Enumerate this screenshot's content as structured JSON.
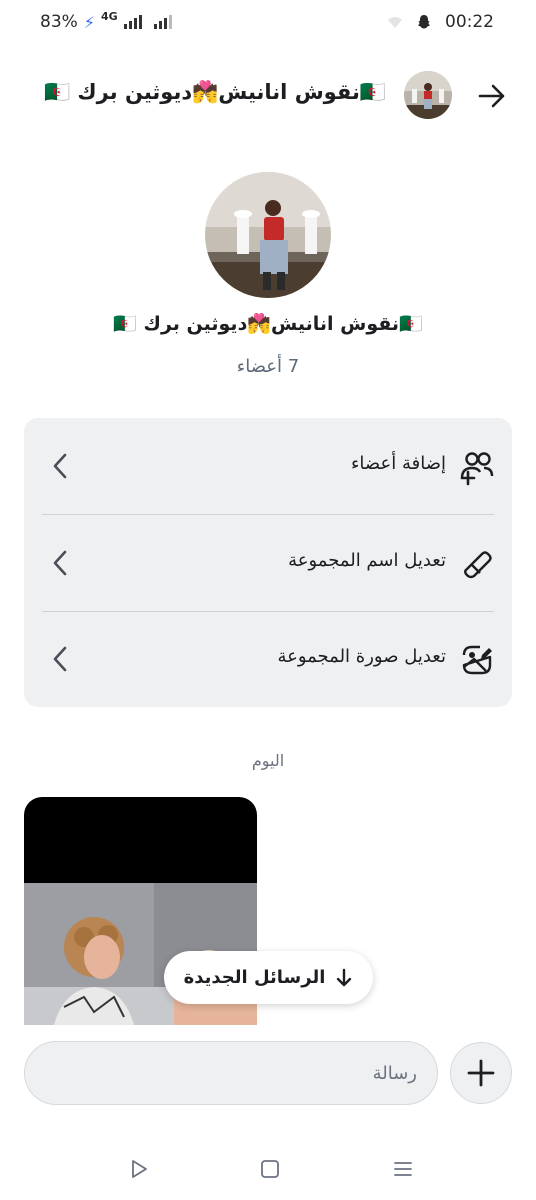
{
  "status_bar": {
    "battery": "83%",
    "network": "4G",
    "time": "00:22"
  },
  "header": {
    "title": "🇩🇿نقوش انانيش💏ديوثين برك 🇩🇿"
  },
  "group": {
    "name": "🇩🇿نقوش انانيش💏ديوثين برك 🇩🇿",
    "members": "7 أعضاء"
  },
  "options": [
    {
      "label": "إضافة أعضاء",
      "icon": "add-members-icon"
    },
    {
      "label": "تعديل اسم المجموعة",
      "icon": "pencil-icon"
    },
    {
      "label": "تعديل صورة المجموعة",
      "icon": "image-edit-icon"
    }
  ],
  "chat": {
    "date_separator": "اليوم",
    "new_messages_label": "الرسائل الجديدة"
  },
  "composer": {
    "placeholder": "رسالة"
  },
  "colors": {
    "card_bg": "#eef0f2",
    "muted_text": "#6b7280",
    "charging_bolt": "#3d6df2"
  }
}
